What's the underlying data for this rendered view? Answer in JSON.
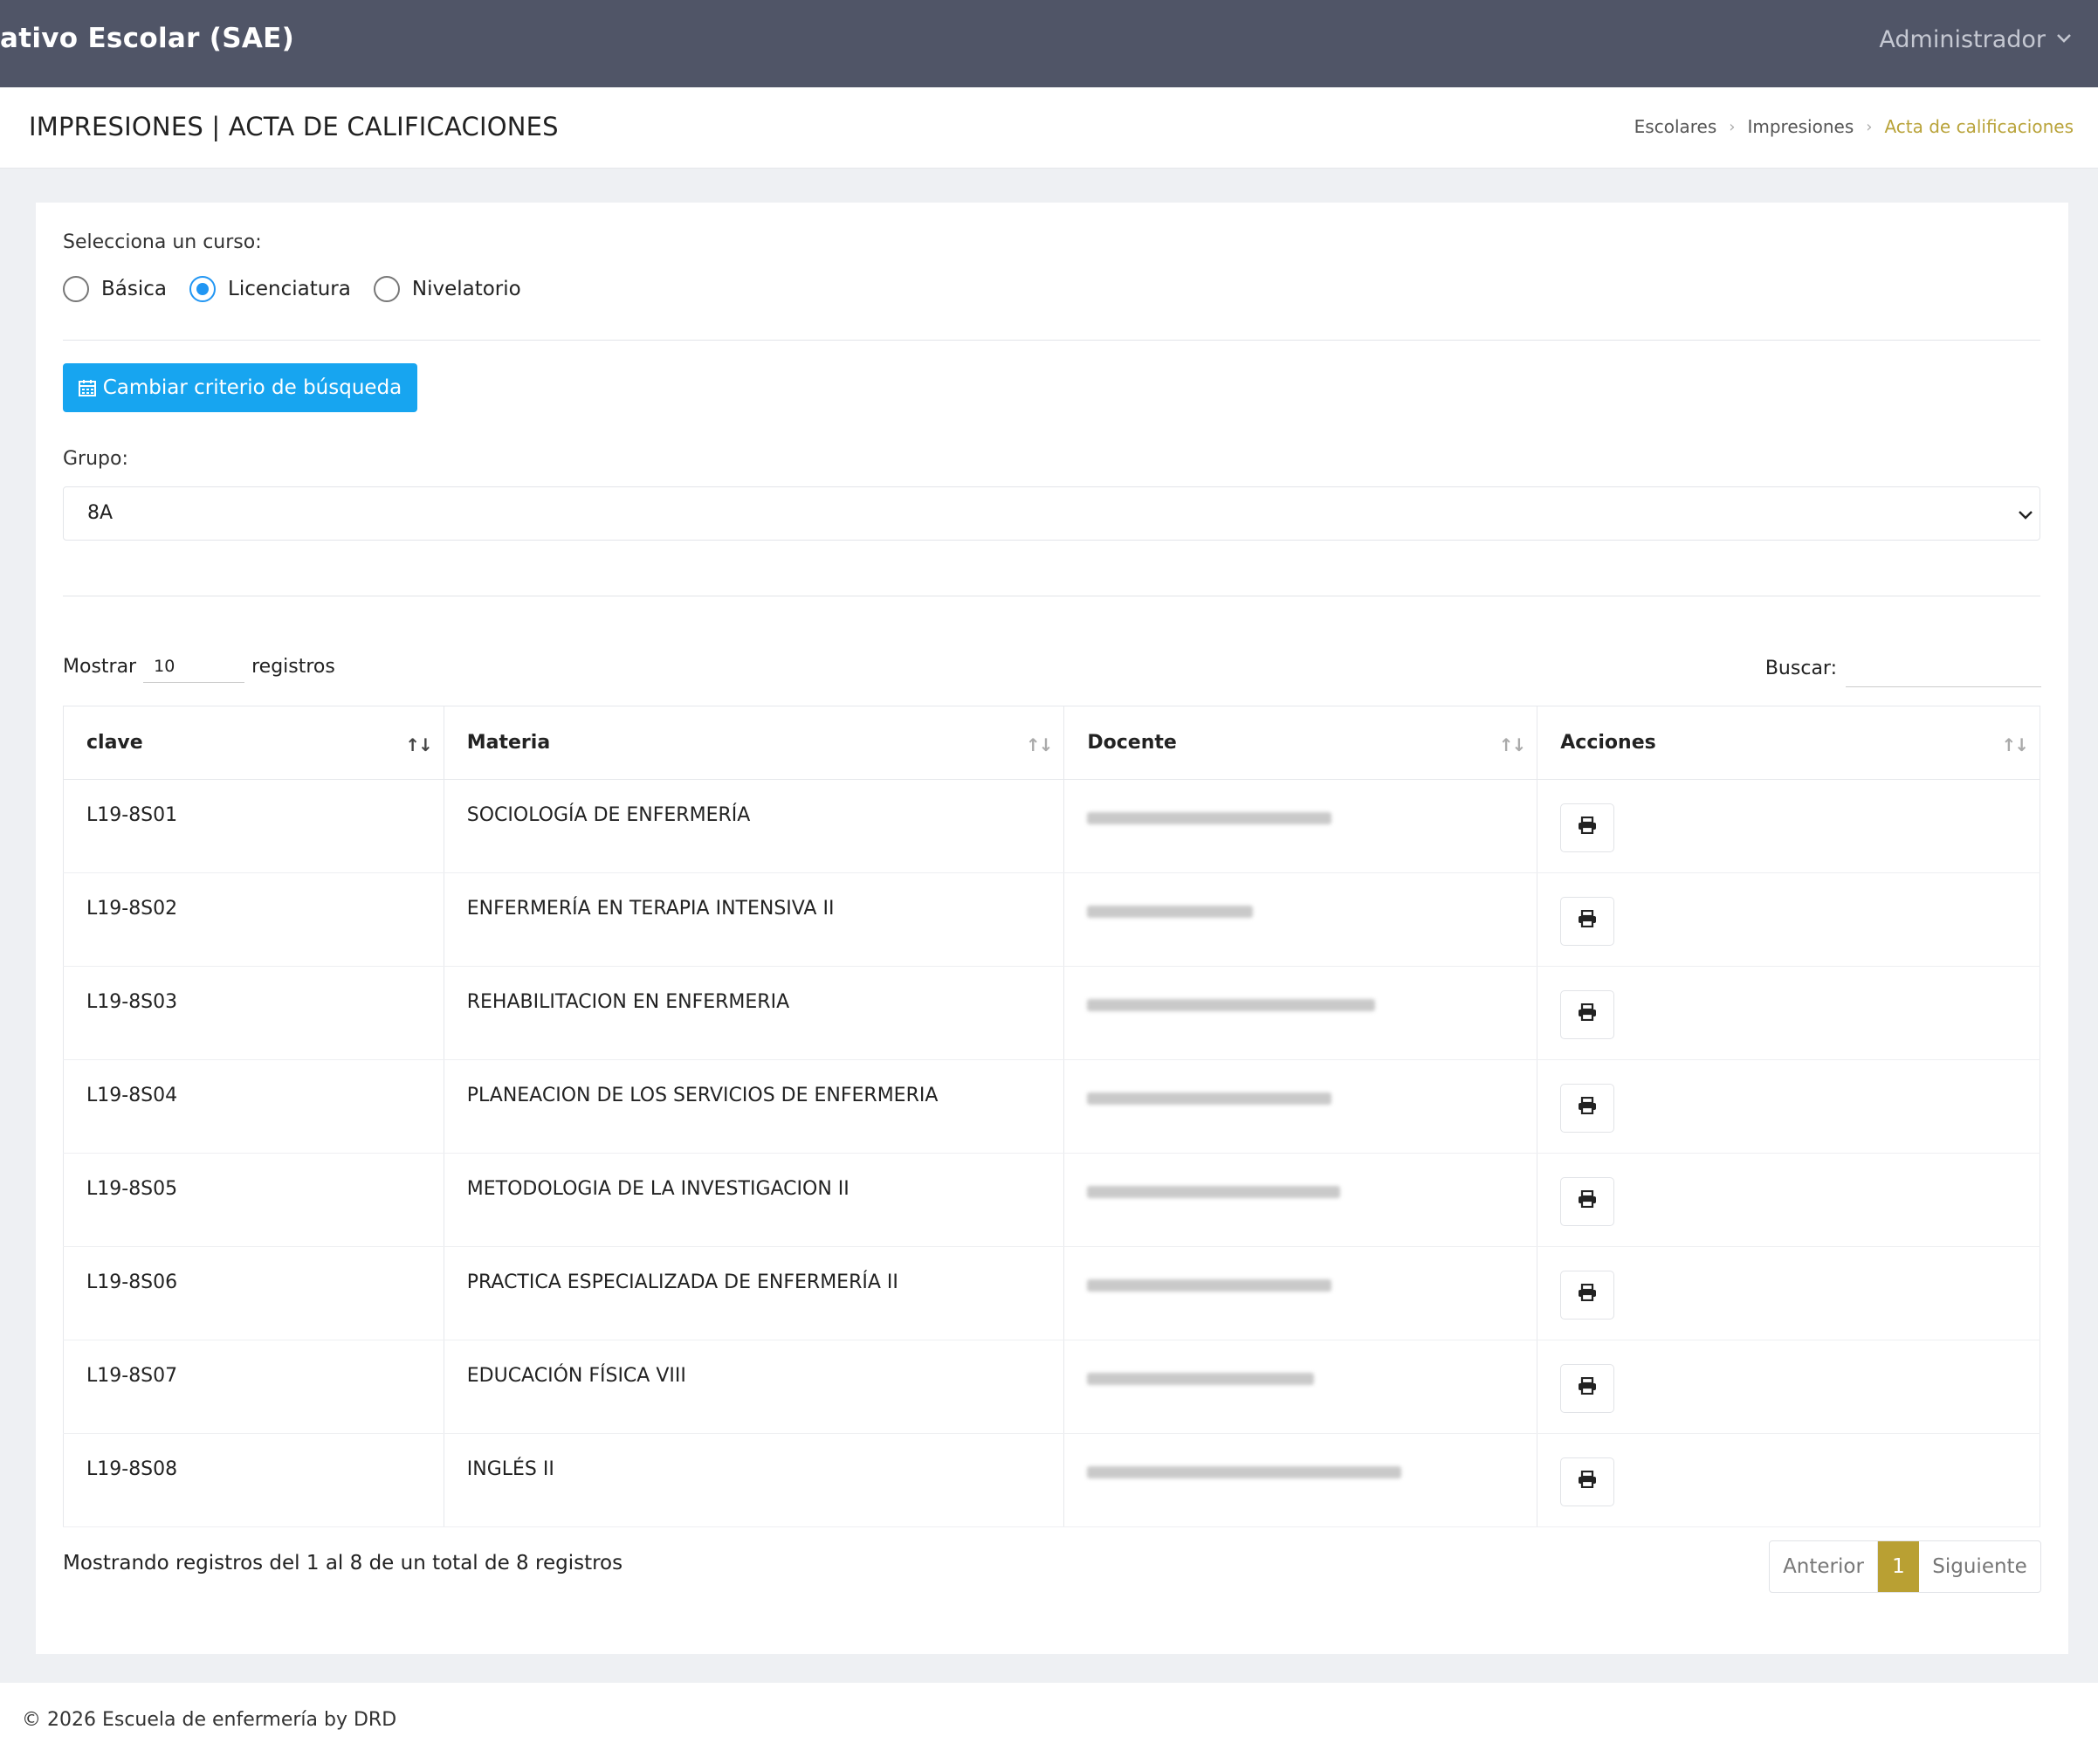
{
  "header": {
    "app_title": "ativo Escolar (SAE)",
    "user_menu": "Administrador"
  },
  "page": {
    "title": "IMPRESIONES | ACTA DE CALIFICACIONES",
    "breadcrumb": [
      "Escolares",
      "Impresiones",
      "Acta de calificaciones"
    ]
  },
  "form": {
    "course_label": "Selecciona un curso:",
    "course_options": [
      {
        "label": "Básica",
        "selected": false
      },
      {
        "label": "Licenciatura",
        "selected": true
      },
      {
        "label": "Nivelatorio",
        "selected": false
      }
    ],
    "change_button": "Cambiar criterio de búsqueda",
    "group_label": "Grupo:",
    "group_value": "8A"
  },
  "datatable": {
    "show_label": "Mostrar",
    "page_length": "10",
    "records_label": "registros",
    "search_label": "Buscar:",
    "columns": [
      "clave",
      "Materia",
      "Docente",
      "Acciones"
    ],
    "rows": [
      {
        "clave": "L19-8S01",
        "materia": "SOCIOLOGÍA DE ENFERMERÍA"
      },
      {
        "clave": "L19-8S02",
        "materia": "ENFERMERÍA EN TERAPIA INTENSIVA II"
      },
      {
        "clave": "L19-8S03",
        "materia": "REHABILITACION EN ENFERMERIA"
      },
      {
        "clave": "L19-8S04",
        "materia": "PLANEACION DE LOS SERVICIOS DE ENFERMERIA"
      },
      {
        "clave": "L19-8S05",
        "materia": "METODOLOGIA DE LA INVESTIGACION II"
      },
      {
        "clave": "L19-8S06",
        "materia": "PRACTICA ESPECIALIZADA DE ENFERMERÍA II"
      },
      {
        "clave": "L19-8S07",
        "materia": "EDUCACIÓN FÍSICA VIII"
      },
      {
        "clave": "L19-8S08",
        "materia": "INGLÉS II"
      }
    ],
    "info": "Mostrando registros del 1 al 8 de un total de 8 registros",
    "pagination": {
      "prev": "Anterior",
      "current": "1",
      "next": "Siguiente"
    }
  },
  "footer": {
    "text": "© 2026 Escuela de enfermería by DRD"
  },
  "colors": {
    "topbar": "#505567",
    "accent_blue": "#17a5f0",
    "accent_gold": "#b9a033"
  }
}
